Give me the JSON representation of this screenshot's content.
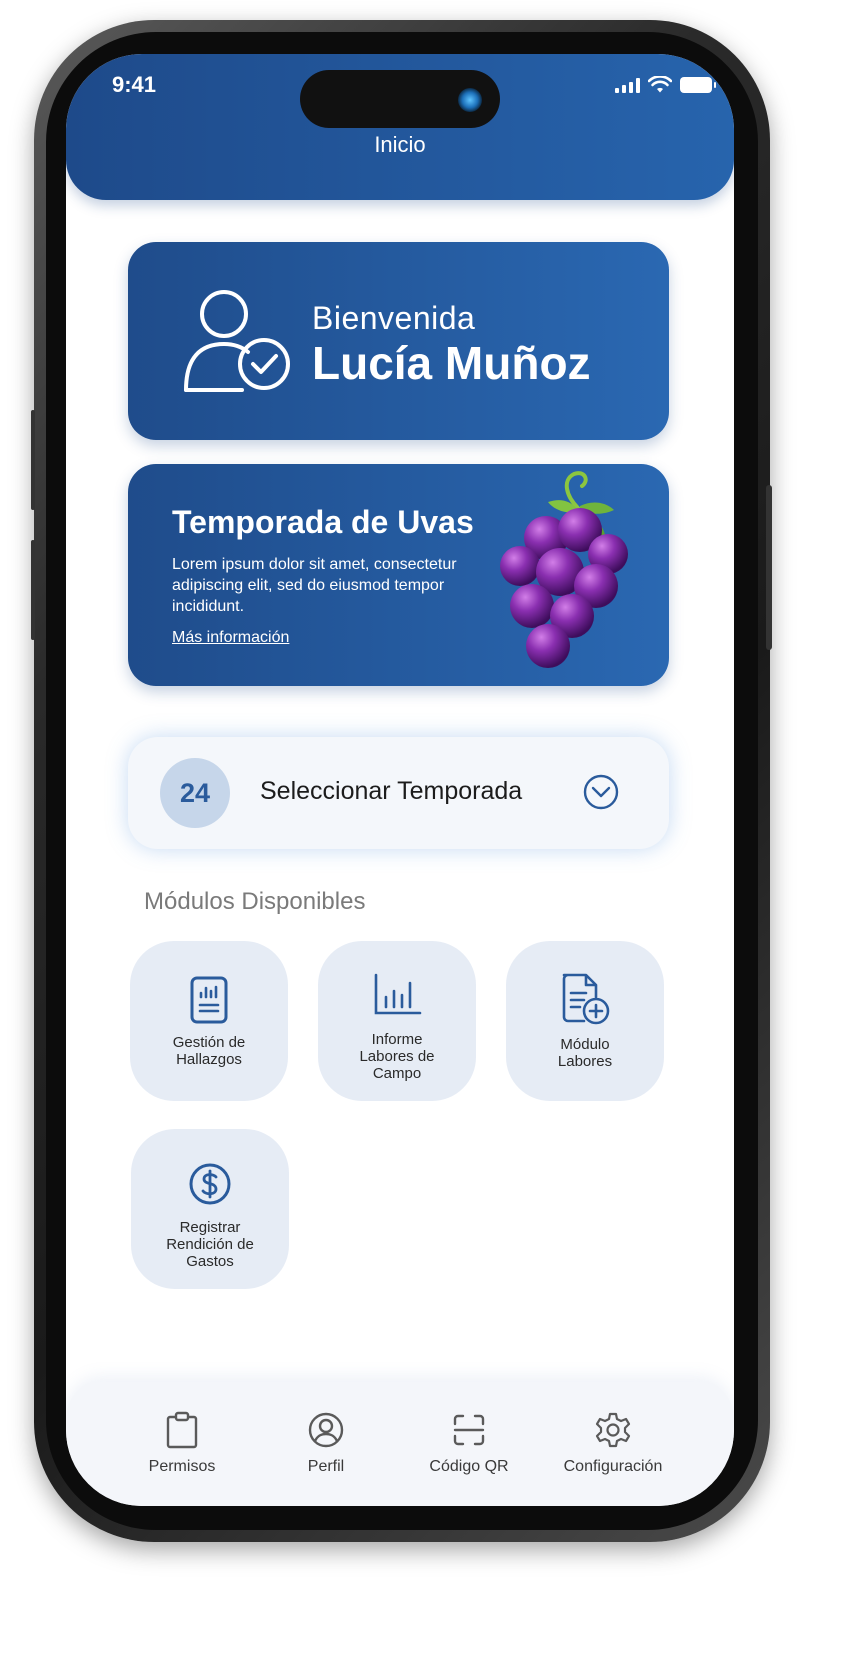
{
  "status_bar": {
    "time": "9:41"
  },
  "header": {
    "title": "Inicio"
  },
  "welcome": {
    "greeting": "Bienvenida",
    "name": "Lucía Muñoz"
  },
  "season_card": {
    "title": "Temporada de Uvas",
    "text": "Lorem ipsum dolor sit amet, consectetur adipiscing elit, sed do eiusmod tempor incididunt.",
    "link": "Más información"
  },
  "season_selector": {
    "badge": "24",
    "label": "Seleccionar Temporada"
  },
  "modules": {
    "title": "Módulos Disponibles",
    "items": [
      {
        "label": "Gestión de\nHallazgos",
        "icon": "document-chart-icon"
      },
      {
        "label": "Informe\nLabores de\nCampo",
        "icon": "bar-chart-icon"
      },
      {
        "label": "Módulo\nLabores",
        "icon": "document-add-icon"
      },
      {
        "label": "Registrar\nRendición de\nGastos",
        "icon": "dollar-icon"
      }
    ]
  },
  "bottom_nav": [
    {
      "label": "Permisos",
      "icon": "clipboard-icon"
    },
    {
      "label": "Perfil",
      "icon": "user-icon"
    },
    {
      "label": "Código QR",
      "icon": "qr-scan-icon"
    },
    {
      "label": "Configuración",
      "icon": "gear-icon"
    }
  ],
  "colors": {
    "primary": "#1f4c8b",
    "primary_light": "#2a68b2",
    "tile_bg": "#e6ecf5",
    "badge_bg": "#c6d6ea",
    "icon_blue": "#2a5b9c"
  }
}
